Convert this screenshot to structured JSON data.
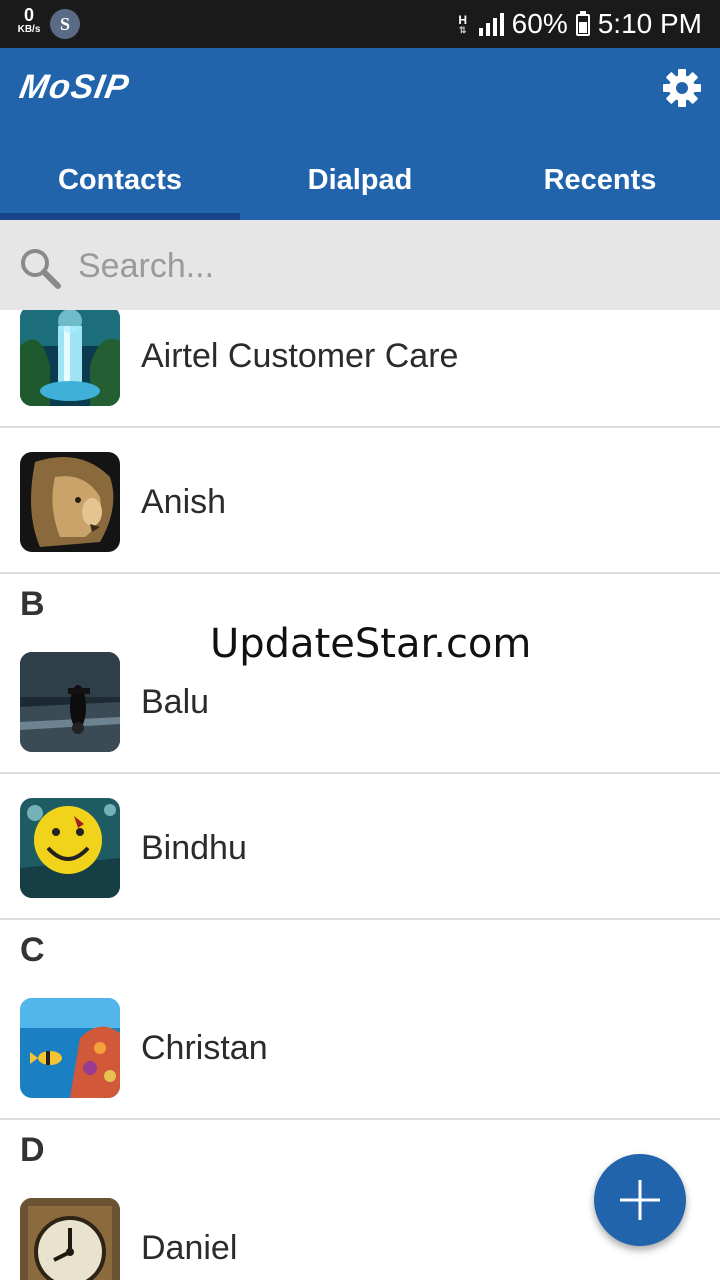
{
  "status_bar": {
    "net_speed_value": "0",
    "net_speed_unit": "KB/s",
    "app_notification_letter": "S",
    "network_type": "H",
    "battery_percent": "60%",
    "time": "5:10 PM"
  },
  "app_bar": {
    "logo_text": "MoSIP",
    "settings_icon": "gear-icon"
  },
  "tabs": [
    {
      "label": "Contacts",
      "active": true
    },
    {
      "label": "Dialpad",
      "active": false
    },
    {
      "label": "Recents",
      "active": false
    }
  ],
  "search": {
    "placeholder": "Search...",
    "value": ""
  },
  "sections": {
    "b": "B",
    "c": "C",
    "d": "D"
  },
  "contacts": [
    {
      "name": "Airtel Customer Care",
      "avatar": "waterfall-image"
    },
    {
      "name": "Anish",
      "avatar": "lion-image"
    },
    {
      "name": "Balu",
      "avatar": "motorcycle-image"
    },
    {
      "name": "Bindhu",
      "avatar": "smiley-image"
    },
    {
      "name": "Christan",
      "avatar": "fish-image"
    },
    {
      "name": "Daniel",
      "avatar": "clock-tower-image"
    }
  ],
  "watermark": "UpdateStar.com",
  "fab": {
    "icon": "plus-icon",
    "accent": "#2164ac"
  },
  "colors": {
    "app_bar": "#2164ac",
    "tab_indicator": "#17448a",
    "status_bar": "#1a1a1a"
  }
}
